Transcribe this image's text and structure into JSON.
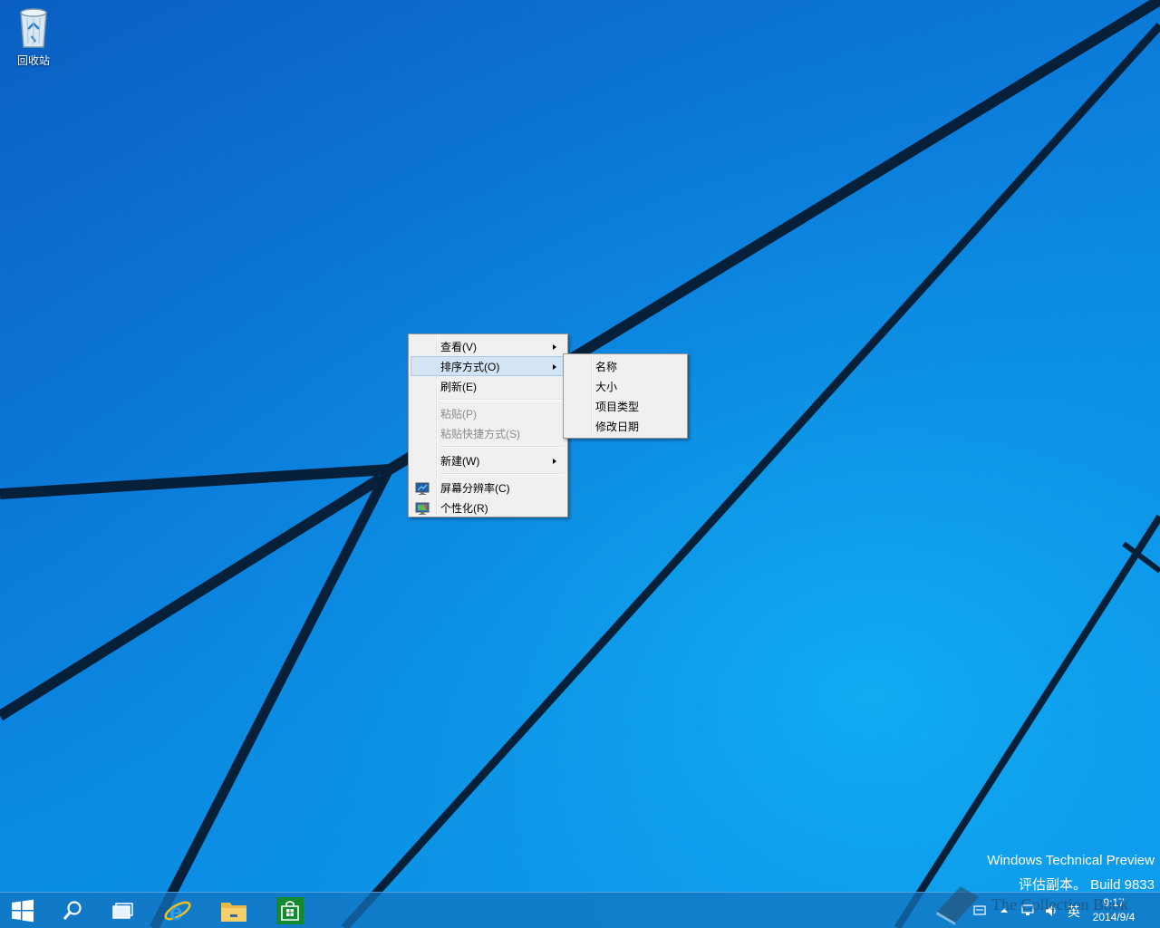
{
  "desktop": {
    "icons": [
      {
        "label": "回收站",
        "icon": "recycle-bin-icon"
      }
    ]
  },
  "context_menu": {
    "items": [
      {
        "label": "查看(V)",
        "submenu": true
      },
      {
        "label": "排序方式(O)",
        "submenu": true,
        "highlighted": true
      },
      {
        "label": "刷新(E)"
      },
      {
        "label": "粘贴(P)",
        "disabled": true
      },
      {
        "label": "粘贴快捷方式(S)",
        "disabled": true
      },
      {
        "label": "新建(W)",
        "submenu": true
      },
      {
        "label": "屏幕分辨率(C)",
        "icon": "display-icon"
      },
      {
        "label": "个性化(R)",
        "icon": "personalize-icon"
      }
    ]
  },
  "sort_submenu": {
    "items": [
      {
        "label": "名称"
      },
      {
        "label": "大小"
      },
      {
        "label": "项目类型"
      },
      {
        "label": "修改日期"
      }
    ]
  },
  "watermark": {
    "line1": "Windows Technical Preview",
    "line2": "评估副本。 Build 9833"
  },
  "taskbar": {
    "buttons": [
      "start-icon",
      "search-icon",
      "task-view-icon",
      "internet-explorer-icon",
      "file-explorer-icon",
      "store-icon"
    ],
    "tray": {
      "ime": "英",
      "time": "9:17",
      "date": "2014/9/4"
    }
  },
  "overlay_watermark": {
    "text": "The Collection Book"
  },
  "colors": {
    "desktop_blue": "#0a8fe6",
    "menu_bg": "#f0f0f0",
    "menu_highlight": "#d5e4f4",
    "taskbar": "#1473be"
  }
}
